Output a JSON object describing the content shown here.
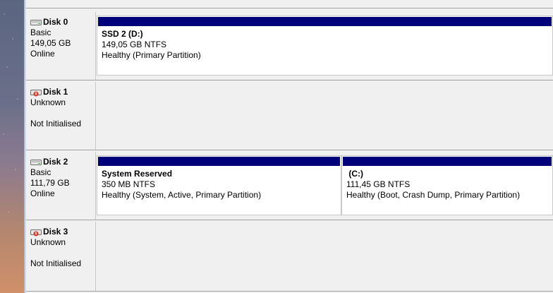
{
  "disks": [
    {
      "name": "Disk 0",
      "lines": [
        "Basic",
        "149,05 GB",
        "Online"
      ],
      "icon": "disk-icon",
      "partitions": [
        {
          "title": "SSD 2  (D:)",
          "size": "149,05 GB NTFS",
          "status": "Healthy (Primary Partition)"
        }
      ]
    },
    {
      "name": "Disk 1",
      "lines": [
        "Unknown",
        "",
        "Not Initialised"
      ],
      "icon": "disk-warning-icon",
      "partitions": []
    },
    {
      "name": "Disk 2",
      "lines": [
        "Basic",
        "111,79 GB",
        "Online"
      ],
      "icon": "disk-icon",
      "partitions": [
        {
          "title": "System Reserved",
          "size": "350 MB NTFS",
          "status": "Healthy (System, Active, Primary Partition)"
        },
        {
          "title": " (C:)",
          "size": "111,45 GB NTFS",
          "status": "Healthy (Boot, Crash Dump, Primary Partition)"
        }
      ]
    },
    {
      "name": "Disk 3",
      "lines": [
        "Unknown",
        "",
        "Not Initialised"
      ],
      "icon": "disk-warning-icon",
      "partitions": []
    }
  ],
  "colors": {
    "partition_bar": "#00007b",
    "background": "#f0f0f0"
  }
}
